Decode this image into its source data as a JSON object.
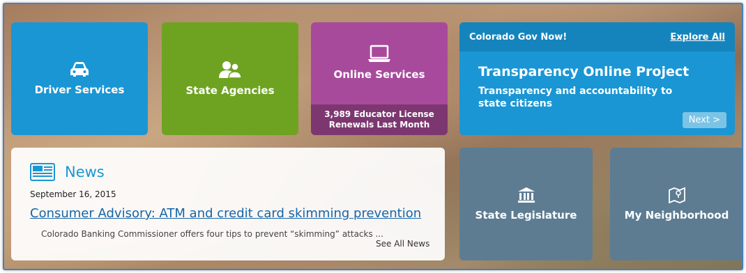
{
  "tiles": {
    "driver": {
      "label": "Driver Services",
      "icon": "car-icon",
      "color": "#1a96d4"
    },
    "agencies": {
      "label": "State Agencies",
      "icon": "people-icon",
      "color": "#6ea321"
    },
    "online": {
      "label": "Online Services",
      "icon": "laptop-icon",
      "color": "#a84a9b",
      "stat_line1": "3,989 Educator License",
      "stat_line2": "Renewals Last Month"
    },
    "legislature": {
      "label": "State Legislature",
      "icon": "capitol-building-icon"
    },
    "neighborhood": {
      "label": "My Neighborhood",
      "icon": "map-icon"
    }
  },
  "gov_now": {
    "header": "Colorado Gov Now!",
    "explore_label": "Explore All",
    "title": "Transparency Online Project",
    "description": "Transparency and accountability to state citizens",
    "next_label": "Next >"
  },
  "news": {
    "label": "News",
    "date": "September 16, 2015",
    "headline": "Consumer Advisory: ATM and credit card skimming prevention",
    "teaser": "Colorado Banking Commissioner offers four tips to prevent “skimming” attacks ...",
    "see_all": "See All News"
  }
}
